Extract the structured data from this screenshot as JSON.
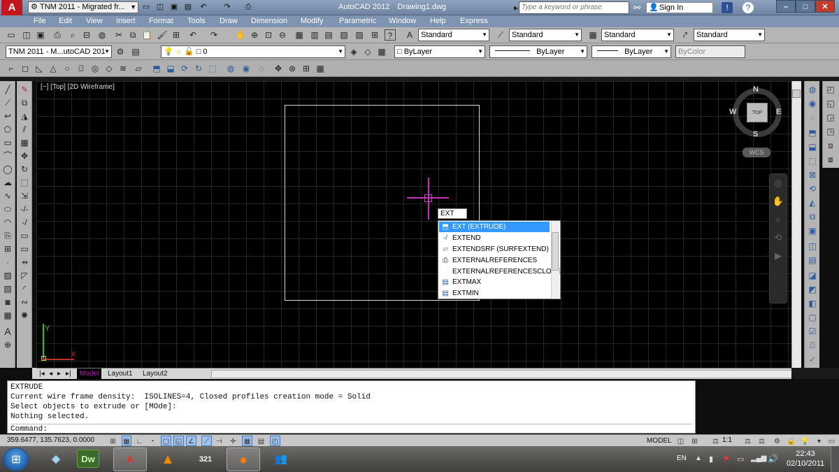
{
  "titlebar": {
    "workspace": "TNM 2011 - Migrated fr...",
    "app_title": "AutoCAD 2012",
    "doc_title": "Drawing1.dwg",
    "search_placeholder": "Type a keyword or phrase",
    "sign_in": "Sign In"
  },
  "menu": [
    "File",
    "Edit",
    "View",
    "Insert",
    "Format",
    "Tools",
    "Draw",
    "Dimension",
    "Modify",
    "Parametric",
    "Window",
    "Help",
    "Express"
  ],
  "styles_toolbar": {
    "text_style": "Standard",
    "dim_style": "Standard",
    "table_style": "Standard",
    "mleader_style": "Standard"
  },
  "layers_toolbar": {
    "workspace_combo": "TNM 2011 - M...utoCAD 201",
    "layer": "0",
    "color": "ByLayer",
    "linetype": "ByLayer",
    "lineweight": "ByLayer",
    "plotstyle": "ByColor"
  },
  "viewport": {
    "label": "[−] [Top] [2D Wireframe]",
    "viewcube_top": "TOP",
    "north": "N",
    "south": "S",
    "east": "E",
    "west": "W",
    "wcs": "WCS",
    "ucs_x": "X",
    "ucs_y": "Y"
  },
  "dynamic_input": "EXT",
  "autocomplete": [
    {
      "label": "EXT (EXTRUDE)",
      "icon": "extrude-icon",
      "selected": true
    },
    {
      "label": "EXTEND",
      "icon": "extend-icon",
      "selected": false
    },
    {
      "label": "EXTENDSRF (SURFEXTEND)",
      "icon": "surfextend-icon",
      "selected": false
    },
    {
      "label": "EXTERNALREFERENCES",
      "icon": "xref-icon",
      "selected": false
    },
    {
      "label": "EXTERNALREFERENCESCLOSE",
      "icon": "",
      "selected": false
    },
    {
      "label": "EXTMAX",
      "icon": "extmax-icon",
      "selected": false
    },
    {
      "label": "EXTMIN",
      "icon": "extmin-icon",
      "selected": false
    }
  ],
  "layout_tabs": [
    "Model",
    "Layout1",
    "Layout2"
  ],
  "command_history": [
    "EXTRUDE",
    "Current wire frame density:  ISOLINES=4, Closed profiles creation mode = Solid",
    "Select objects to extrude or [MOde]:",
    "Nothing selected."
  ],
  "command_prompt": "Command:",
  "statusbar": {
    "coords": "359.6477, 135.7623, 0.0000",
    "model": "MODEL",
    "scale": "1:1"
  },
  "taskbar": {
    "lang": "EN",
    "time": "22:43",
    "date": "02/10/2011"
  },
  "colors": {
    "crosshair": "#c930b8",
    "selection": "#3399ff",
    "ucs_x": "#c03030",
    "ucs_y": "#2fbf2f"
  }
}
